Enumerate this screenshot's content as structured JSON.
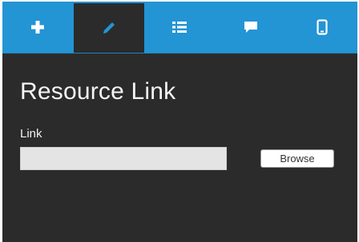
{
  "toolbar": {
    "tabs": [
      {
        "icon": "plus-icon",
        "active": false
      },
      {
        "icon": "pencil-icon",
        "active": true
      },
      {
        "icon": "list-icon",
        "active": false
      },
      {
        "icon": "comment-icon",
        "active": false
      },
      {
        "icon": "mobile-icon",
        "active": false
      }
    ],
    "background_color": "#2394d4",
    "active_tab_color": "#2b2b2b"
  },
  "panel": {
    "title": "Resource Link",
    "link_field": {
      "label": "Link",
      "value": "",
      "placeholder": ""
    },
    "browse_label": "Browse"
  }
}
